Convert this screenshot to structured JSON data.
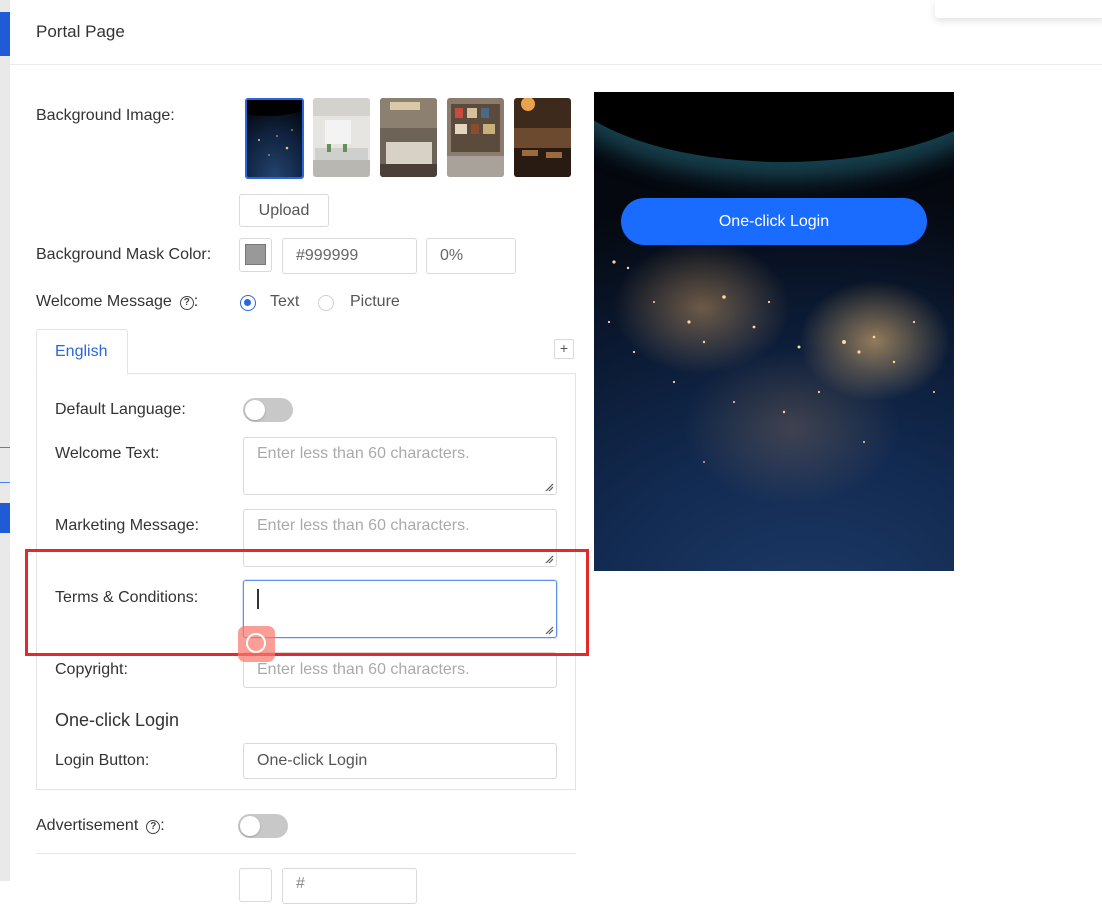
{
  "panel": {
    "title": "Portal Page"
  },
  "background_image": {
    "label": "Background Image:",
    "upload_label": "Upload"
  },
  "mask_color": {
    "label": "Background Mask Color:",
    "color_value": "#999999",
    "opacity_value": "0%",
    "swatch_color": "#999999"
  },
  "welcome_message": {
    "label": "Welcome Message",
    "colon": ":",
    "help_icon": "?",
    "options": [
      "Text",
      "Picture"
    ],
    "selected": "Text"
  },
  "language_tab": {
    "tabs": [
      "English"
    ],
    "add_symbol": "+"
  },
  "form": {
    "default_language_label": "Default Language:",
    "welcome_text_label": "Welcome Text:",
    "welcome_text_placeholder": "Enter less than 60 characters.",
    "marketing_label": "Marketing Message:",
    "marketing_placeholder": "Enter less than 60 characters.",
    "terms_label": "Terms & Conditions:",
    "copyright_label": "Copyright:",
    "copyright_placeholder": "Enter less than 60 characters.",
    "one_click_section": "One-click Login",
    "login_button_label": "Login Button:",
    "login_button_value": "One-click Login"
  },
  "advertisement": {
    "label": "Advertisement",
    "colon": ":",
    "help_icon": "?"
  },
  "welcome_text_color": {
    "color_value": "#"
  },
  "preview": {
    "login_button": "One-click Login",
    "button_color": "#1a6bff"
  },
  "accent_color": "#2a66e0",
  "highlight_color": "#e52929"
}
